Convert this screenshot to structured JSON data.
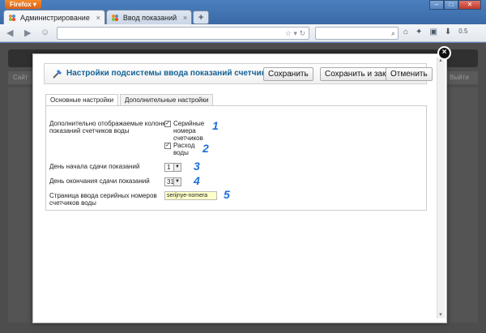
{
  "browser": {
    "menu_label": "Firefox ▾",
    "tabs": [
      {
        "label": "Администрирование"
      },
      {
        "label": "Ввод показаний"
      }
    ],
    "new_tab": "+",
    "tab_close": "×",
    "toolbar_badge": "0.5"
  },
  "modal": {
    "title": "Настройки подсистемы ввода показаний счетчиков",
    "close": "×",
    "buttons": {
      "save": "Сохранить",
      "save_close": "Сохранить и закрыть",
      "cancel": "Отменить"
    },
    "tabs": [
      {
        "label": "Основные настройки",
        "active": true
      },
      {
        "label": "Дополнительные настройки",
        "active": false
      }
    ],
    "form": {
      "columns_label": "Дополнительно отображаемые колонки показаний счетчиков воды",
      "option1_label": "Серийные номера счетчиков",
      "option1_checked": true,
      "option2_label": "Расход воды",
      "option2_checked": true,
      "start_day_label": "День начала сдачи показаний",
      "start_day_value": "1",
      "end_day_label": "День окончания сдачи показаний",
      "end_day_value": "31",
      "page_label": "Страница ввода серийных номеров счетчиков воды",
      "page_value": "serijnye-nomera"
    },
    "markers": [
      "1",
      "2",
      "3",
      "4",
      "5"
    ]
  },
  "background": {
    "left_text": "Сайт",
    "right_text": "Выйти"
  },
  "colors": {
    "title": "#146295",
    "marker": "#1e6fd9",
    "input_bg": "#ffffc8"
  }
}
